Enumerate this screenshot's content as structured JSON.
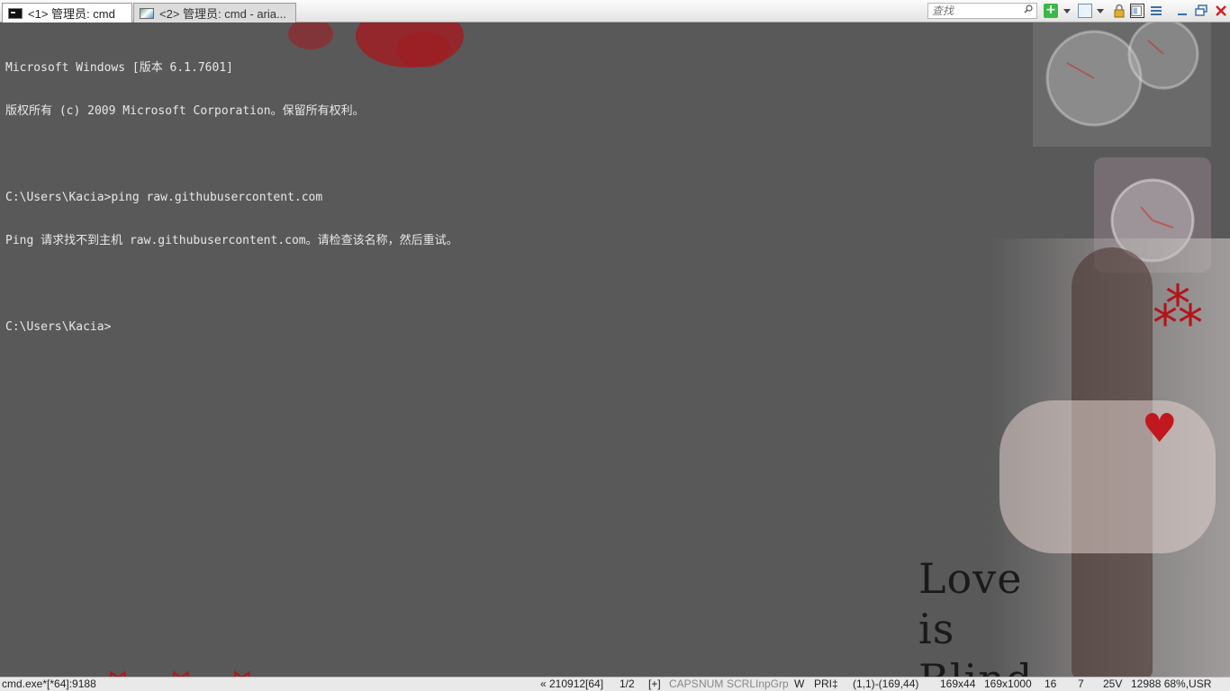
{
  "tabs": [
    {
      "label": "<1> 管理员: cmd",
      "icon": "cmd-icon",
      "active": true
    },
    {
      "label": "<2> 管理员: cmd - aria...",
      "icon": "aria-icon",
      "active": false
    }
  ],
  "toolbar": {
    "search_placeholder": "查找",
    "new_console_symbol": "+"
  },
  "terminal": {
    "lines": [
      "Microsoft Windows [版本 6.1.7601]",
      "版权所有 (c) 2009 Microsoft Corporation。保留所有权利。",
      "",
      "C:\\Users\\Kacia>ping raw.githubusercontent.com",
      "Ping 请求找不到主机 raw.githubusercontent.com。请检查该名称，然后重试。",
      "",
      "C:\\Users\\Kacia>"
    ]
  },
  "background": {
    "text_lines": [
      "Love",
      "is",
      "Blind"
    ]
  },
  "statusbar": {
    "process": "cmd.exe*[*64]:9188",
    "build": "« 210912[64]",
    "console_index": "1/2",
    "new": "[+]",
    "caps": "CAPS",
    "num": "NUM",
    "scrl": "SCRL",
    "inpgrp": "InpGrp",
    "w": "W",
    "pri": "PRI‡",
    "selection": "(1,1)-(169,44)",
    "window_size": "169x44",
    "buffer_size": "169x1000",
    "v16": "16",
    "v7": "7",
    "v25v": "25V",
    "pid_info": "12988 68%,USR"
  },
  "colors": {
    "console_bg": "#595959",
    "console_fg": "#e8e8e8",
    "statusbar_bg": "#e9e9e9"
  }
}
